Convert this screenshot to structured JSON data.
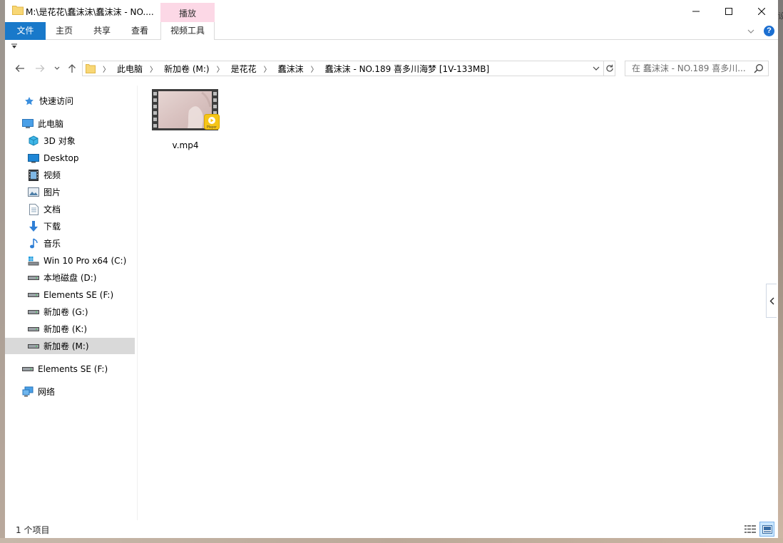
{
  "window": {
    "title": "M:\\是花花\\蠢沫沫\\蠢沫沫 - NO....",
    "context_tab_header": "播放"
  },
  "ribbon": {
    "tabs": [
      {
        "label": "文件"
      },
      {
        "label": "主页"
      },
      {
        "label": "共享"
      },
      {
        "label": "查看"
      },
      {
        "label": "视频工具"
      }
    ],
    "help_glyph": "?"
  },
  "address_bar": {
    "breadcrumbs": [
      "此电脑",
      "新加卷 (M:)",
      "是花花",
      "蠢沫沫",
      "蠢沫沫 - NO.189 喜多川海梦 [1V-133MB]"
    ]
  },
  "search": {
    "placeholder": "在 蠢沫沫 - NO.189 喜多川..."
  },
  "sidebar": {
    "items": [
      {
        "label": "快速访问",
        "icon": "star-icon"
      },
      {
        "label": "此电脑",
        "icon": "computer-icon"
      },
      {
        "label": "3D 对象",
        "icon": "3d-objects-icon"
      },
      {
        "label": "Desktop",
        "icon": "desktop-icon"
      },
      {
        "label": "视频",
        "icon": "video-icon"
      },
      {
        "label": "图片",
        "icon": "pictures-icon"
      },
      {
        "label": "文档",
        "icon": "documents-icon"
      },
      {
        "label": "下载",
        "icon": "download-icon"
      },
      {
        "label": "音乐",
        "icon": "music-icon"
      },
      {
        "label": "Win 10 Pro x64 (C:)",
        "icon": "windows-drive-icon"
      },
      {
        "label": "本地磁盘 (D:)",
        "icon": "drive-icon"
      },
      {
        "label": "Elements SE (F:)",
        "icon": "drive-icon"
      },
      {
        "label": "新加卷 (G:)",
        "icon": "drive-icon"
      },
      {
        "label": "新加卷 (K:)",
        "icon": "drive-icon"
      },
      {
        "label": "新加卷 (M:)",
        "icon": "drive-icon",
        "selected": true
      },
      {
        "label": "Elements SE (F:)",
        "icon": "drive-icon"
      },
      {
        "label": "网络",
        "icon": "network-icon"
      }
    ]
  },
  "files": [
    {
      "name": "v.mp4",
      "icon": "video-file-thumbnail",
      "badge": "Player"
    }
  ],
  "status_bar": {
    "item_count": "1 个项目"
  },
  "colors": {
    "file_tab": "#1979ca",
    "context_tab": "#fcd8e6",
    "selection": "#d9d9d9",
    "help": "#1c6fd1"
  }
}
